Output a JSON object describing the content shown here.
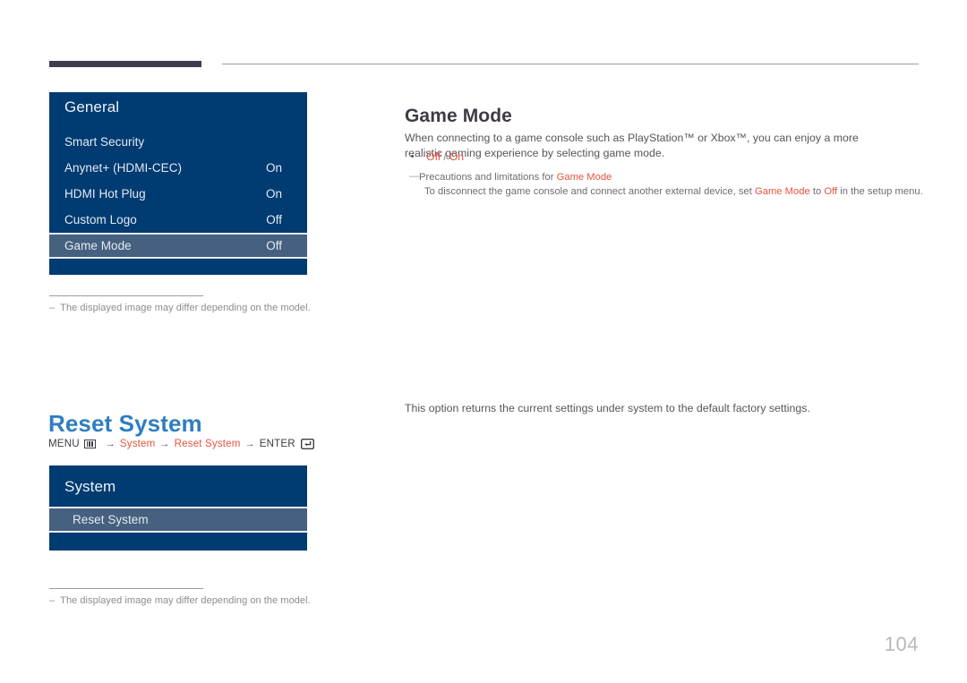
{
  "page": {
    "number": "104"
  },
  "sections": [
    {
      "id": "game-mode",
      "heading": "Game Mode",
      "body": "When connecting to a game console such as PlayStation™ or Xbox™, you can enjoy a more realistic gaming experience by selecting game mode.",
      "bullet": {
        "option_a": "Off",
        "separator": "/",
        "option_b": "On"
      },
      "note": {
        "line1_pre": "Precautions and limitations for ",
        "line1_hl": "Game Mode",
        "line2_pre": "To disconnect the game console and connect another external device, set ",
        "line2_hl1": "Game Mode",
        "line2_mid": " to ",
        "line2_hl2": "Off",
        "line2_post": " in the setup menu."
      },
      "osd": {
        "title": "General",
        "rows": [
          {
            "label": "Smart Security",
            "value": "",
            "selected": false
          },
          {
            "label": "Anynet+ (HDMI-CEC)",
            "value": "On",
            "selected": false
          },
          {
            "label": "HDMI Hot Plug",
            "value": "On",
            "selected": false
          },
          {
            "label": "Custom Logo",
            "value": "Off",
            "selected": false
          },
          {
            "label": "Game Mode",
            "value": "Off",
            "selected": true
          }
        ]
      },
      "footnote": {
        "dash": "–",
        "text": "The displayed image may differ depending on the model."
      }
    },
    {
      "id": "reset-system",
      "heading": "Reset System",
      "body": "This option returns the current settings under system to the default factory settings.",
      "menu_path": {
        "menu_label": "MENU",
        "menu_icon": "menu-icon",
        "arrow": "→",
        "step1": "System",
        "step2": "Reset System",
        "enter_label": "ENTER",
        "enter_icon": "enter-key-icon"
      },
      "osd": {
        "title": "System",
        "rows": [
          {
            "label": "Reset System",
            "value": "",
            "selected": true
          }
        ]
      },
      "footnote": {
        "dash": "–",
        "text": "The displayed image may differ depending on the model."
      }
    }
  ],
  "colors": {
    "osd_background": "#003b72",
    "osd_selected": "#45617f",
    "accent_orange": "#e8523f",
    "heading_blue": "#2f7ec0",
    "heading_dark": "#3f3a46",
    "header_bar": "#413c4a"
  }
}
